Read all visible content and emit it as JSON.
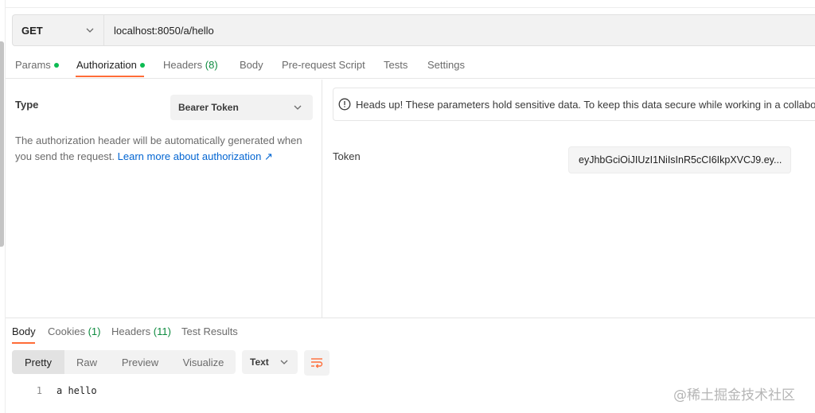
{
  "request": {
    "method": "GET",
    "url": "localhost:8050/a/hello"
  },
  "request_tabs": [
    {
      "label": "Params",
      "dot": true
    },
    {
      "label": "Authorization",
      "dot": true,
      "active": true
    },
    {
      "label": "Headers",
      "count": "(8)"
    },
    {
      "label": "Body"
    },
    {
      "label": "Pre-request Script"
    },
    {
      "label": "Tests"
    },
    {
      "label": "Settings"
    }
  ],
  "auth": {
    "type_label": "Type",
    "type_value": "Bearer Token",
    "description": "The authorization header will be automatically generated when you send the request.",
    "learn_more": "Learn more about authorization",
    "learn_more_arrow": "↗",
    "notice": "Heads up! These parameters hold sensitive data. To keep this data secure while working in a collabora",
    "token_label": "Token",
    "token_value": "eyJhbGciOiJIUzI1NiIsInR5cCI6IkpXVCJ9.ey...",
    "token_ellipsis": "..."
  },
  "response_tabs": [
    {
      "label": "Body",
      "active": true
    },
    {
      "label": "Cookies",
      "count": "(1)"
    },
    {
      "label": "Headers",
      "count": "(11)"
    },
    {
      "label": "Test Results"
    }
  ],
  "view_modes": [
    "Pretty",
    "Raw",
    "Preview",
    "Visualize"
  ],
  "format": "Text",
  "code": [
    {
      "line": "1",
      "text": "a hello"
    }
  ],
  "watermark": "@稀土掘金技术社区",
  "colors": {
    "accent": "#ff6c37",
    "link": "#0265d2",
    "status_dot": "#0cbb52"
  }
}
